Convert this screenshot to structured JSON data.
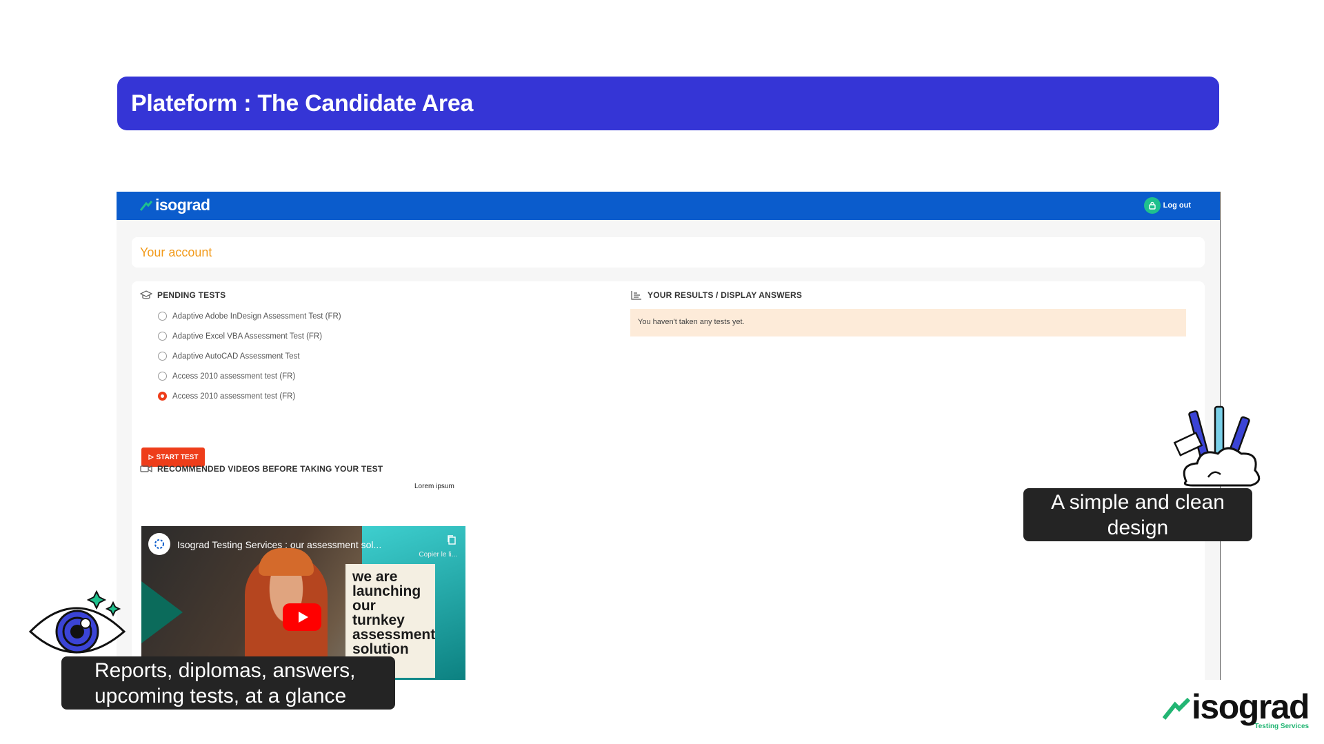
{
  "colors": {
    "title_bg": "#3535d6",
    "app_header": "#0b5ccc",
    "accent_orange": "#f29a1a",
    "start_button": "#ee3d1a",
    "logout_icon_bg": "#1fc08d",
    "notice_bg": "#fdebd9",
    "callout_bg": "#242424",
    "brand_green": "#22b573"
  },
  "slide": {
    "title": "Plateform : The Candidate Area"
  },
  "app": {
    "brand": "isograd",
    "logout_label": "Log out",
    "account_label": "Your account",
    "pending": {
      "heading": "PENDING TESTS",
      "icon": "graduation-cap-icon",
      "tests": [
        {
          "label": "Adaptive Adobe InDesign Assessment Test (FR)",
          "selected": false
        },
        {
          "label": "Adaptive Excel VBA Assessment Test (FR)",
          "selected": false
        },
        {
          "label": "Adaptive AutoCAD Assessment Test",
          "selected": false
        },
        {
          "label": "Access 2010 assessment test (FR)",
          "selected": false
        },
        {
          "label": "Access 2010 assessment test (FR)",
          "selected": true
        }
      ],
      "start_label": "START TEST"
    },
    "lorem": "Lorem ipsum",
    "videos": {
      "heading": "RECOMMENDED VIDEOS BEFORE TAKING YOUR TEST",
      "icon": "video-camera-icon",
      "video_title": "Isograd Testing Services : our assessment sol...",
      "copy_label": "Copier le li...",
      "thumbnail_text": "we are launching our turnkey assessment solution"
    },
    "results": {
      "heading": "YOUR RESULTS / DISPLAY ANSWERS",
      "icon": "bar-chart-icon",
      "notice": "You haven't taken any tests yet."
    }
  },
  "callouts": {
    "right": "A simple and clean design",
    "left": "Reports, diplomas, answers, upcoming tests, at a glance"
  },
  "footer_logo": {
    "word": "isograd",
    "sub": "Testing Services"
  }
}
